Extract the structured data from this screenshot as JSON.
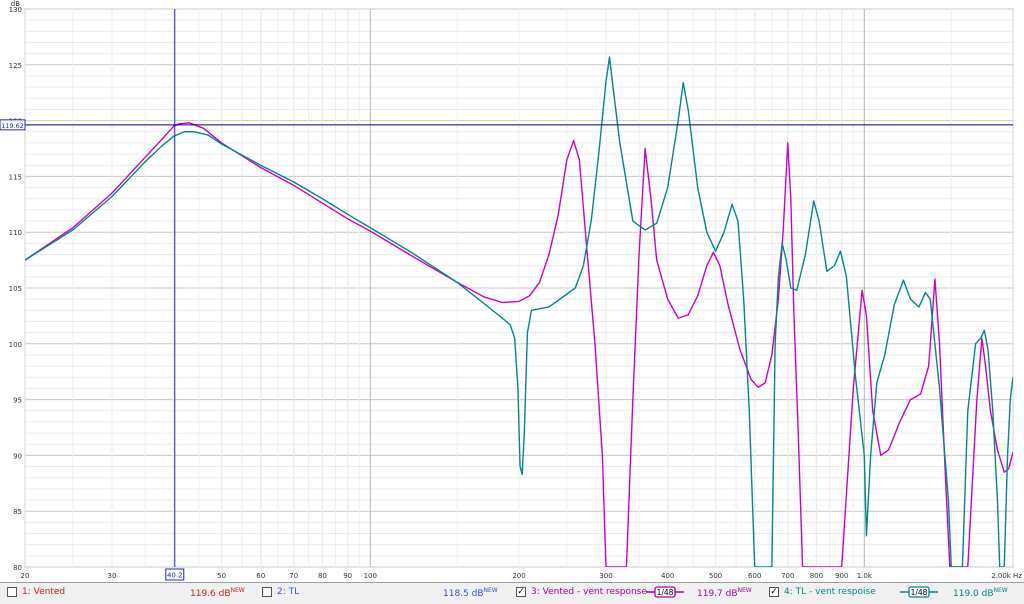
{
  "chart_data": {
    "type": "line",
    "xscale": "log",
    "xlim": [
      20,
      2000
    ],
    "ylim": [
      80,
      130
    ],
    "yunit": "dB",
    "xunit": "Hz",
    "ytick_labels": [
      "130",
      "125",
      "120",
      "115",
      "110",
      "105",
      "100",
      "95",
      "90",
      "85",
      "80"
    ],
    "xtick_labels": [
      {
        "v": 20,
        "t": "20"
      },
      {
        "v": 30,
        "t": "30"
      },
      {
        "v": 50,
        "t": "50"
      },
      {
        "v": 60,
        "t": "60"
      },
      {
        "v": 70,
        "t": "70"
      },
      {
        "v": 80,
        "t": "80"
      },
      {
        "v": 90,
        "t": "90"
      },
      {
        "v": 100,
        "t": "100"
      },
      {
        "v": 200,
        "t": "200"
      },
      {
        "v": 300,
        "t": "300"
      },
      {
        "v": 400,
        "t": "400"
      },
      {
        "v": 500,
        "t": "500"
      },
      {
        "v": 600,
        "t": "600"
      },
      {
        "v": 700,
        "t": "700"
      },
      {
        "v": 800,
        "t": "800"
      },
      {
        "v": 900,
        "t": "900"
      },
      {
        "v": 1000,
        "t": "1.0k"
      },
      {
        "v": 2000,
        "t": "2.00k Hz"
      }
    ],
    "cursor": {
      "x": 40.2,
      "x_label": "40.2",
      "y": 119.62,
      "y_label": "119.62"
    },
    "series": [
      {
        "name": "3: Vented - vent response",
        "color": "#cc00cc",
        "points": [
          [
            20,
            107.5
          ],
          [
            25,
            110.4
          ],
          [
            30,
            113.5
          ],
          [
            35,
            116.7
          ],
          [
            38,
            118.4
          ],
          [
            40,
            119.5
          ],
          [
            41,
            119.7
          ],
          [
            43,
            119.8
          ],
          [
            46,
            119.3
          ],
          [
            50,
            118.0
          ],
          [
            60,
            115.8
          ],
          [
            70,
            114.2
          ],
          [
            80,
            112.6
          ],
          [
            90,
            111.2
          ],
          [
            100,
            110.1
          ],
          [
            120,
            108.0
          ],
          [
            150,
            105.5
          ],
          [
            170,
            104.2
          ],
          [
            185,
            103.7
          ],
          [
            200,
            103.8
          ],
          [
            210,
            104.3
          ],
          [
            220,
            105.5
          ],
          [
            230,
            108.0
          ],
          [
            240,
            111.5
          ],
          [
            250,
            116.5
          ],
          [
            258,
            118.2
          ],
          [
            265,
            116.5
          ],
          [
            275,
            108.0
          ],
          [
            285,
            100.0
          ],
          [
            295,
            90.0
          ],
          [
            300,
            80.0
          ],
          [
            330,
            80.0
          ],
          [
            340,
            95.0
          ],
          [
            350,
            108.0
          ],
          [
            360,
            117.5
          ],
          [
            370,
            113.0
          ],
          [
            380,
            107.5
          ],
          [
            400,
            104.0
          ],
          [
            420,
            102.3
          ],
          [
            440,
            102.6
          ],
          [
            460,
            104.3
          ],
          [
            480,
            107.0
          ],
          [
            495,
            108.2
          ],
          [
            510,
            107.0
          ],
          [
            530,
            103.5
          ],
          [
            560,
            99.5
          ],
          [
            590,
            96.8
          ],
          [
            610,
            96.1
          ],
          [
            630,
            96.5
          ],
          [
            650,
            99.0
          ],
          [
            670,
            104.0
          ],
          [
            685,
            110.0
          ],
          [
            700,
            118.0
          ],
          [
            710,
            113.0
          ],
          [
            720,
            103.0
          ],
          [
            735,
            92.0
          ],
          [
            750,
            80.0
          ],
          [
            900,
            80.0
          ],
          [
            950,
            96.0
          ],
          [
            990,
            104.8
          ],
          [
            1010,
            102.5
          ],
          [
            1040,
            94.0
          ],
          [
            1080,
            90.0
          ],
          [
            1120,
            90.5
          ],
          [
            1180,
            93.0
          ],
          [
            1240,
            95.0
          ],
          [
            1300,
            95.5
          ],
          [
            1350,
            98.0
          ],
          [
            1390,
            105.8
          ],
          [
            1420,
            100.0
          ],
          [
            1460,
            88.0
          ],
          [
            1490,
            80.0
          ],
          [
            1620,
            80.0
          ],
          [
            1690,
            95.0
          ],
          [
            1730,
            100.5
          ],
          [
            1760,
            98.0
          ],
          [
            1800,
            94.0
          ],
          [
            1860,
            90.5
          ],
          [
            1920,
            88.5
          ],
          [
            1960,
            88.8
          ],
          [
            2000,
            90.3
          ]
        ]
      },
      {
        "name": "4: TL - vent respoise",
        "color": "#008888",
        "points": [
          [
            20,
            107.5
          ],
          [
            25,
            110.2
          ],
          [
            30,
            113.2
          ],
          [
            35,
            116.3
          ],
          [
            38,
            117.8
          ],
          [
            40,
            118.6
          ],
          [
            42,
            119.0
          ],
          [
            44,
            119.0
          ],
          [
            47,
            118.7
          ],
          [
            50,
            117.9
          ],
          [
            60,
            116.0
          ],
          [
            70,
            114.5
          ],
          [
            80,
            113.0
          ],
          [
            90,
            111.6
          ],
          [
            100,
            110.4
          ],
          [
            120,
            108.3
          ],
          [
            150,
            105.5
          ],
          [
            170,
            103.6
          ],
          [
            185,
            102.3
          ],
          [
            192,
            101.7
          ],
          [
            196,
            100.5
          ],
          [
            199,
            96.0
          ],
          [
            201,
            89.0
          ],
          [
            203,
            88.3
          ],
          [
            205,
            92.0
          ],
          [
            208,
            101.0
          ],
          [
            212,
            103.0
          ],
          [
            230,
            103.3
          ],
          [
            260,
            105.0
          ],
          [
            270,
            107.0
          ],
          [
            280,
            111.0
          ],
          [
            290,
            117.0
          ],
          [
            300,
            123.5
          ],
          [
            305,
            125.7
          ],
          [
            310,
            123.0
          ],
          [
            320,
            118.0
          ],
          [
            340,
            111.0
          ],
          [
            360,
            110.2
          ],
          [
            380,
            110.8
          ],
          [
            400,
            114.0
          ],
          [
            420,
            120.0
          ],
          [
            430,
            123.4
          ],
          [
            440,
            121.0
          ],
          [
            460,
            114.0
          ],
          [
            480,
            110.0
          ],
          [
            500,
            108.3
          ],
          [
            520,
            110.0
          ],
          [
            540,
            112.5
          ],
          [
            555,
            111.0
          ],
          [
            570,
            104.0
          ],
          [
            585,
            94.0
          ],
          [
            600,
            80.0
          ],
          [
            650,
            80.0
          ],
          [
            660,
            100.0
          ],
          [
            670,
            106.0
          ],
          [
            682,
            109.0
          ],
          [
            695,
            107.5
          ],
          [
            710,
            105.0
          ],
          [
            730,
            104.8
          ],
          [
            760,
            108.0
          ],
          [
            790,
            112.8
          ],
          [
            810,
            111.0
          ],
          [
            840,
            106.5
          ],
          [
            870,
            107.0
          ],
          [
            895,
            108.3
          ],
          [
            920,
            106.0
          ],
          [
            960,
            97.0
          ],
          [
            1000,
            90.0
          ],
          [
            1010,
            82.8
          ],
          [
            1030,
            90.0
          ],
          [
            1060,
            96.5
          ],
          [
            1100,
            99.0
          ],
          [
            1150,
            103.5
          ],
          [
            1200,
            105.7
          ],
          [
            1240,
            104.0
          ],
          [
            1290,
            103.3
          ],
          [
            1330,
            104.6
          ],
          [
            1360,
            104.0
          ],
          [
            1420,
            96.0
          ],
          [
            1480,
            86.0
          ],
          [
            1500,
            80.0
          ],
          [
            1580,
            80.0
          ],
          [
            1620,
            94.0
          ],
          [
            1680,
            100.0
          ],
          [
            1720,
            100.5
          ],
          [
            1750,
            101.2
          ],
          [
            1780,
            99.5
          ],
          [
            1820,
            94.0
          ],
          [
            1860,
            86.0
          ],
          [
            1880,
            80.0
          ],
          [
            1920,
            80.0
          ],
          [
            1950,
            90.0
          ],
          [
            1975,
            95.0
          ],
          [
            2000,
            97.0
          ]
        ]
      }
    ]
  },
  "legend": [
    {
      "checked": false,
      "label": "1: Vented",
      "value": "119.6 dB",
      "badge": "NEW",
      "color": "#cc2222"
    },
    {
      "checked": false,
      "label": "2: TL",
      "value": "118.5 dB",
      "badge": "NEW",
      "color": "#3355cc"
    },
    {
      "checked": true,
      "label": "3: Vented - vent response",
      "value": "119.7 dB",
      "badge": "NEW",
      "color": "#aa00aa",
      "smoothing": "1/48"
    },
    {
      "checked": true,
      "label": "4: TL - vent respoise",
      "value": "119.0 dB",
      "badge": "NEW",
      "color": "#008888",
      "smoothing": "1/48"
    }
  ]
}
